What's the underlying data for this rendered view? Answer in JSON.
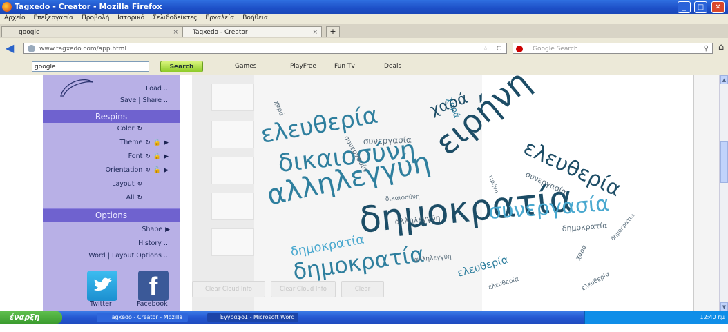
{
  "window": {
    "title": "Tagxedo - Creator - Mozilla Firefox"
  },
  "menubar": [
    "Αρχείο",
    "Επεξεργασία",
    "Προβολή",
    "Ιστορικό",
    "Σελιδοδείκτες",
    "Εργαλεία",
    "Βοήθεια"
  ],
  "tabs": [
    {
      "label": "google"
    },
    {
      "label": "Tagxedo - Creator"
    }
  ],
  "navbar": {
    "url": "www.tagxedo.com/app.html",
    "search_placeholder": "Google Search"
  },
  "toolbar2": {
    "query": "google",
    "search_label": "Search",
    "items": [
      "Games",
      "PlayFree",
      "Fun Tv",
      "Deals"
    ]
  },
  "left_panel": {
    "load": "Load ...",
    "save_share": "Save | Share ...",
    "respins_header": "Respins",
    "color": "Color",
    "theme": "Theme",
    "font": "Font",
    "orientation": "Orientation",
    "layout": "Layout",
    "all": "All",
    "options_header": "Options",
    "shape": "Shape",
    "history": "History ...",
    "word_layout_options": "Word | Layout Options ...",
    "twitter": "Twitter",
    "facebook": "Facebook"
  },
  "bottom_buttons": [
    "Clear Cloud Info",
    "Clear Cloud Info",
    "Clear"
  ],
  "word_cloud": {
    "colors": {
      "dark": "#1d4d66",
      "teal": "#2f7f9e",
      "light": "#49a8cf",
      "grey": "#5a6e7c"
    },
    "words": [
      "δημοκρατία",
      "δημοκρατία",
      "δημοκρατία",
      "αλληλεγγύη",
      "δικαιοσύνη",
      "ελευθερία",
      "ελευθερία",
      "ειρήνη",
      "συνεργασία",
      "συνεργασία",
      "χαρά",
      "δημοκρατία",
      "αλληλεγγύη",
      "ελευθερία",
      "ελευθερία",
      "χαρά",
      "χαρά",
      "συνεργασία",
      "αλληλεγγύη",
      "δημοκρατία",
      "ελευθερία",
      "ειρήνη",
      "χαρά",
      "συνεργασία",
      "δικαιοσύνη"
    ]
  },
  "taskbar": {
    "start": "έναρξη",
    "tasks": [
      "Tagxedo - Creator - Mozilla Firefox",
      "Έγγραφο1 - Microsoft Word"
    ],
    "clock": "12:40 πμ"
  }
}
